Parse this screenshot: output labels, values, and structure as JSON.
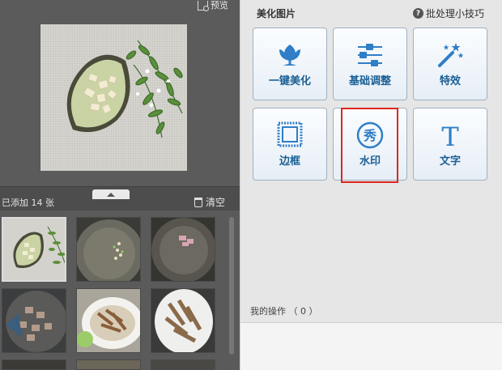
{
  "preview": {
    "label": "预览",
    "icon": "preview-icon"
  },
  "photo_list": {
    "added_label": "已添加 14 张",
    "clear_label": "清空",
    "clear_icon": "trash-icon",
    "collapse_icon": "chevron-up-icon"
  },
  "panel": {
    "title": "美化图片",
    "tips_label": "批处理小技巧",
    "tips_icon": "question-icon"
  },
  "tools": [
    {
      "label": "一键美化",
      "icon": "tulip-icon"
    },
    {
      "label": "基础调整",
      "icon": "sliders-icon"
    },
    {
      "label": "特效",
      "icon": "magic-wand-icon"
    },
    {
      "label": "边框",
      "icon": "frame-icon"
    },
    {
      "label": "水印",
      "icon": "watermark-icon"
    },
    {
      "label": "文字",
      "icon": "text-icon"
    }
  ],
  "watermark_glyph": "秀",
  "text_glyph": "T",
  "operations": {
    "label": "我的操作 （ 0 ）"
  },
  "colors": {
    "tool_text": "#1a5f94",
    "highlight": "#e0261f",
    "left_bg": "#5a5a5a"
  }
}
